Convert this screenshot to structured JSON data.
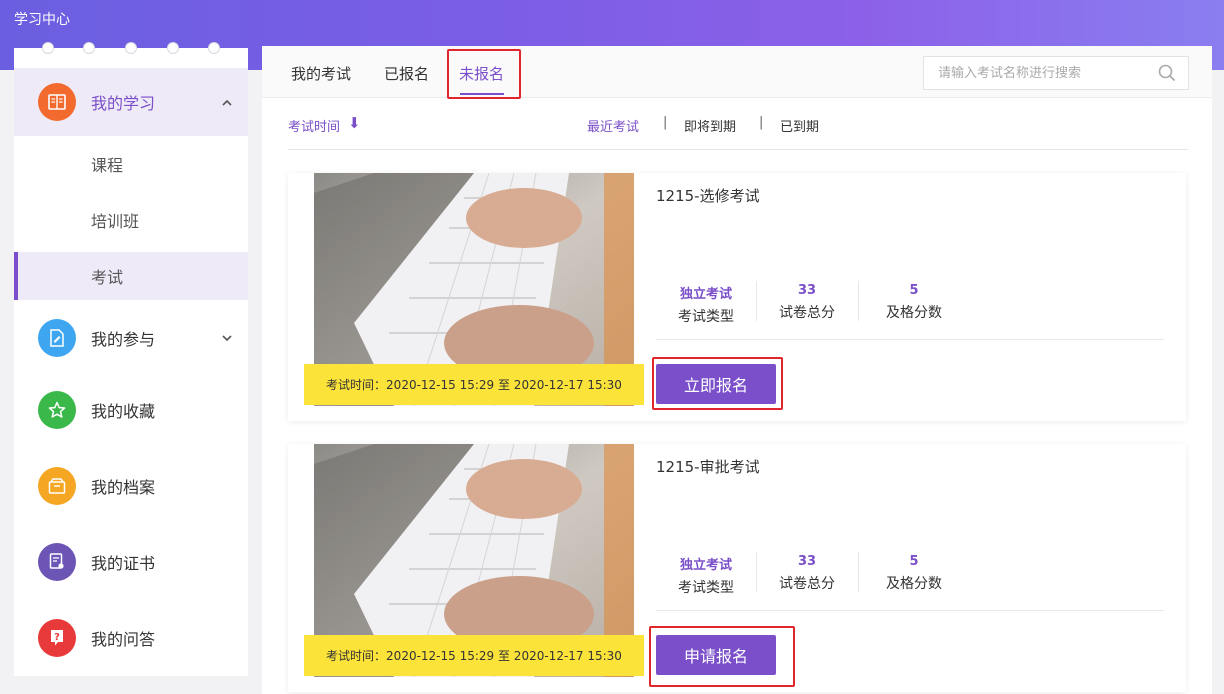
{
  "app": {
    "title": "学习中心"
  },
  "colors": {
    "accent": "#7a4fc9",
    "highlight": "#fbe33a",
    "annotation": "#e0262b"
  },
  "sidebar": {
    "items": [
      {
        "label": "我的学习",
        "icon": "book-icon",
        "color": "#f26a2e",
        "expanded": true,
        "children": [
          {
            "label": "课程"
          },
          {
            "label": "培训班"
          },
          {
            "label": "考试",
            "selected": true
          }
        ]
      },
      {
        "label": "我的参与",
        "icon": "edit-doc-icon",
        "color": "#3ea6f0"
      },
      {
        "label": "我的收藏",
        "icon": "star-icon",
        "color": "#3bb84a"
      },
      {
        "label": "我的档案",
        "icon": "archive-box-icon",
        "color": "#f5a623"
      },
      {
        "label": "我的证书",
        "icon": "certificate-icon",
        "color": "#6c55b5"
      },
      {
        "label": "我的问答",
        "icon": "question-icon",
        "color": "#e83a3a"
      }
    ]
  },
  "tabs": [
    {
      "label": "我的考试"
    },
    {
      "label": "已报名"
    },
    {
      "label": "未报名",
      "active": true
    }
  ],
  "search": {
    "placeholder": "请输入考试名称进行搜索",
    "value": ""
  },
  "filters": {
    "sort_label": "考试时间",
    "sort_arrow": "⬇",
    "links": [
      "最近考试",
      "即将到期",
      "已到期"
    ],
    "separator": "|"
  },
  "exams": [
    {
      "title": "1215-选修考试",
      "time_text": "考试时间：2020-12-15 15:29 至 2020-12-17 15:30",
      "stats": [
        {
          "value": "独立考试",
          "label": "考试类型"
        },
        {
          "value": "33",
          "label": "试卷总分"
        },
        {
          "value": "5",
          "label": "及格分数"
        }
      ],
      "button": "立即报名"
    },
    {
      "title": "1215-审批考试",
      "time_text": "考试时间：2020-12-15 15:29 至 2020-12-17 15:30",
      "stats": [
        {
          "value": "独立考试",
          "label": "考试类型"
        },
        {
          "value": "33",
          "label": "试卷总分"
        },
        {
          "value": "5",
          "label": "及格分数"
        }
      ],
      "button": "申请报名"
    }
  ]
}
